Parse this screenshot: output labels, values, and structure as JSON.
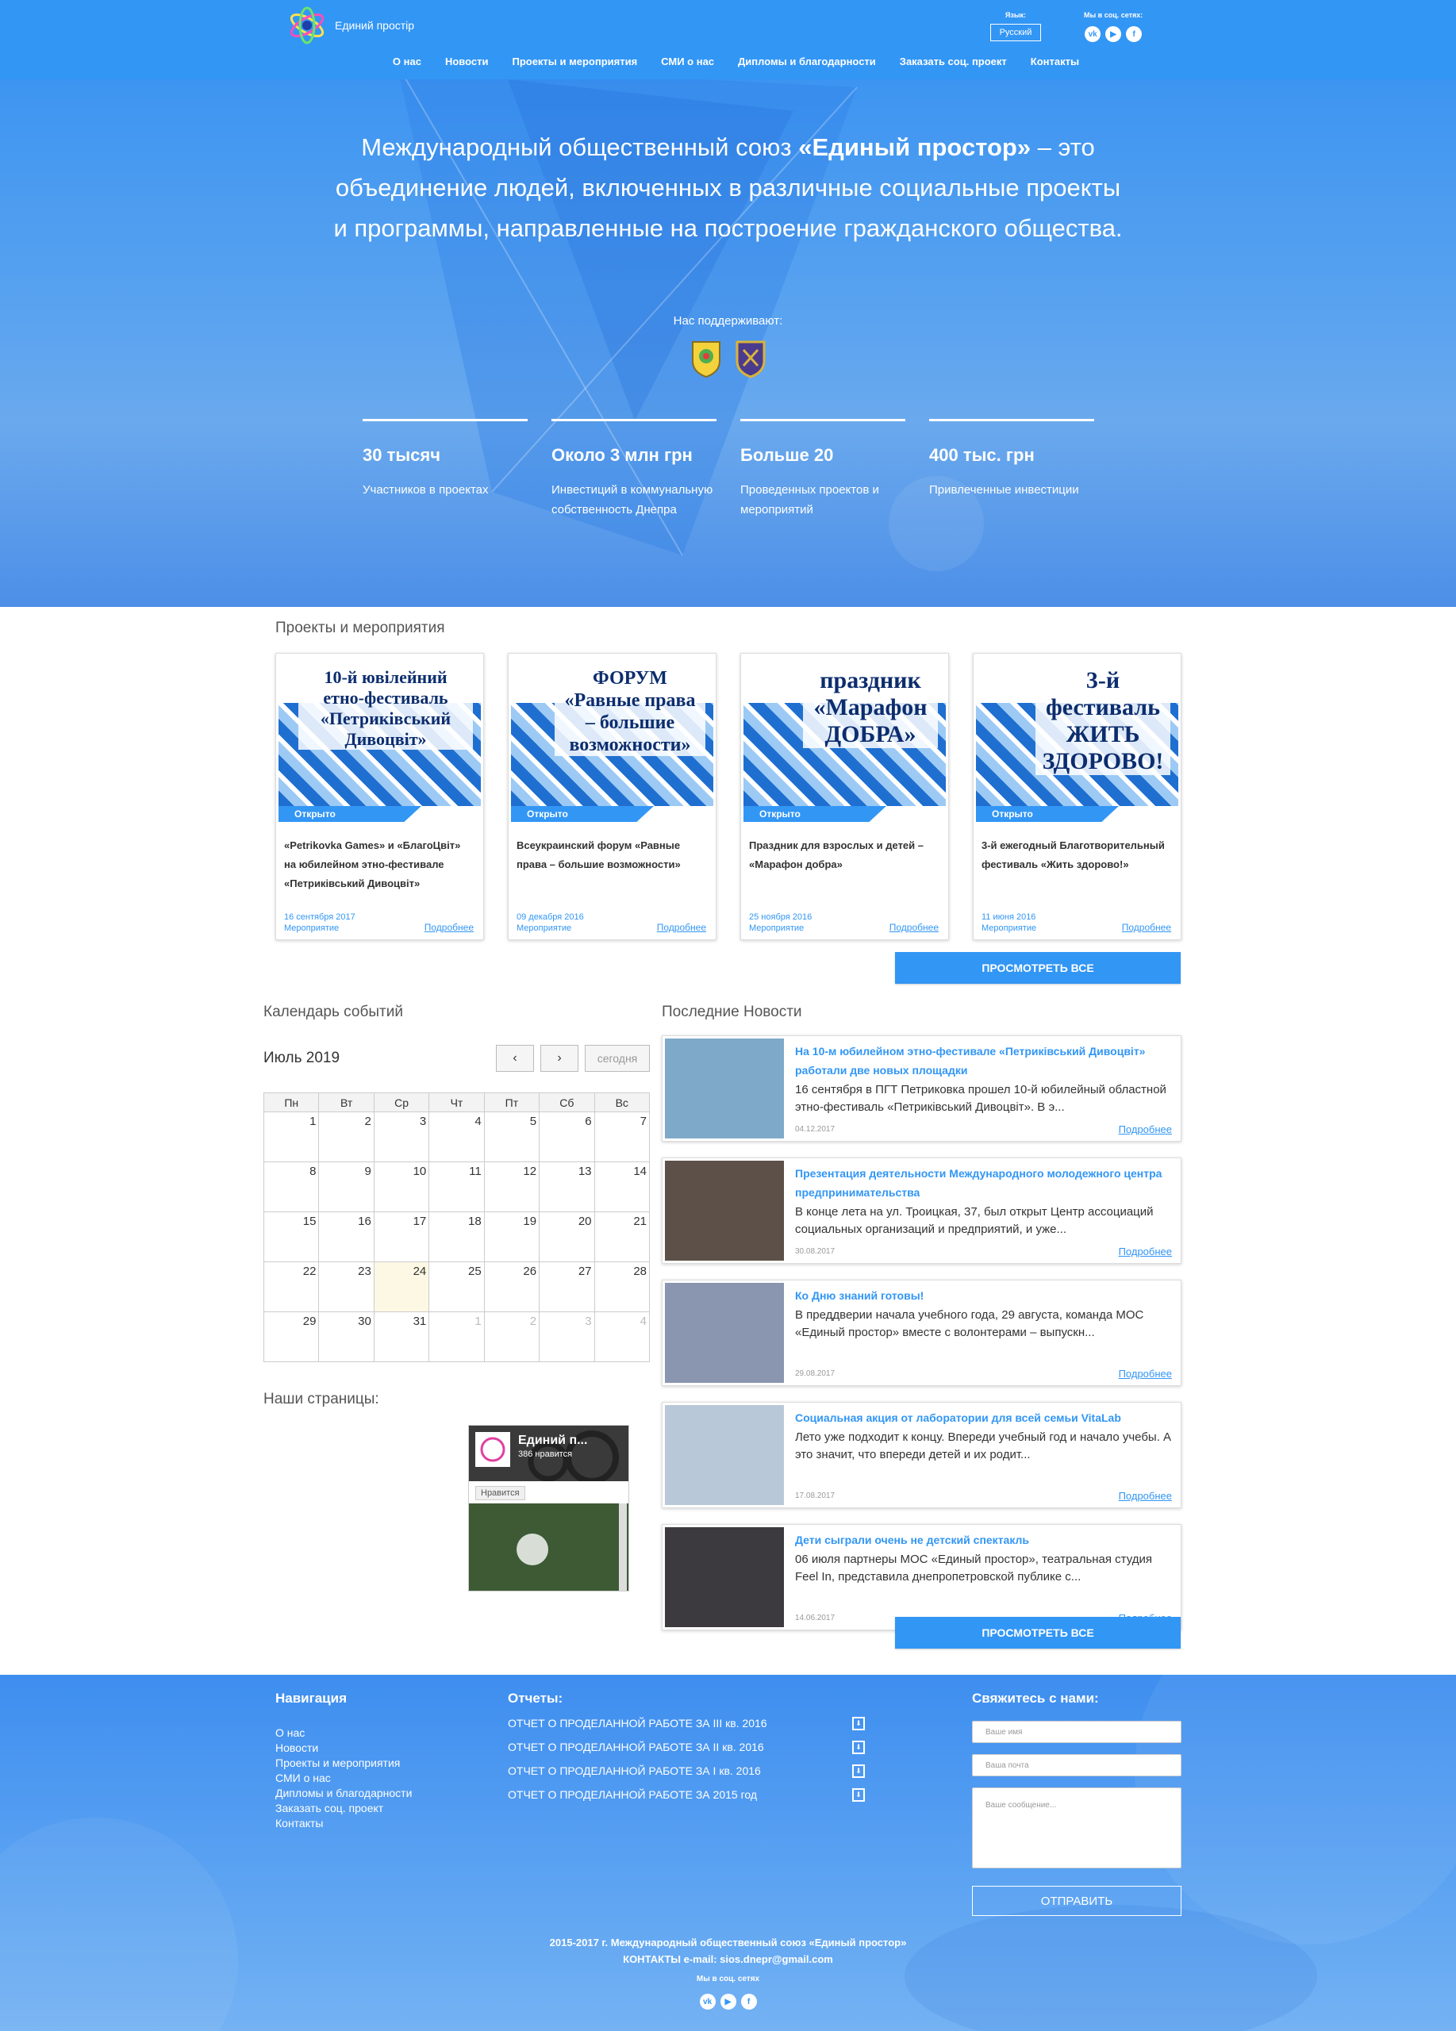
{
  "header": {
    "logo_text": "Единий простір",
    "lang_label": "Язык:",
    "lang_value": "Русский",
    "social_label": "Мы в соц. сетях:",
    "social_icons": [
      "vk-icon",
      "youtube-icon",
      "facebook-icon"
    ],
    "nav": [
      "О нас",
      "Новости",
      "Проекты и мероприятия",
      "СМИ о нас",
      "Дипломы и благодарности",
      "Заказать соц. проект",
      "Контакты"
    ]
  },
  "hero": {
    "text_before": "Международный общественный союз ",
    "text_bold": "«Единый простор»",
    "text_after": " – это объединение людей, включенных в различные социальные проекты и программы, направленные на построение гражданского общества.",
    "support_label": "Нас поддерживают:",
    "stats": [
      {
        "value": "30 тысяч",
        "label": "Участников в проектах"
      },
      {
        "value": "Около 3 млн грн",
        "label": "Инвестиций в коммунальную собственность Днепра"
      },
      {
        "value": "Больше 20",
        "label": "Проведенных проектов и мероприятий"
      },
      {
        "value": "400 тыс. грн",
        "label": "Привлеченные инвестиции"
      }
    ]
  },
  "projects": {
    "title": "Проекты и мероприятия",
    "cards": [
      {
        "poster": "10-й ювілейний етно-фестиваль «Петриківський Дивоцвіт»",
        "badge": "Открыто",
        "title": "«Petrikovka Games» и «БлагоЦвіт» на юбилейном этно-фестивале «Петриківський Дивоцвіт»",
        "date": "16 сентября 2017",
        "type": "Мероприятие",
        "more": "Подробнее"
      },
      {
        "poster": "ФОРУМ «Равные права – большие возможности»",
        "badge": "Открыто",
        "title": "Всеукраинский форум «Равные права – большие возможности»",
        "date": "09 декабря 2016",
        "type": "Мероприятие",
        "more": "Подробнее"
      },
      {
        "poster": "праздник «Марафон ДОБРА»",
        "badge": "Открыто",
        "title": "Праздник для взрослых и детей – «Марафон добра»",
        "date": "25 ноября 2016",
        "type": "Мероприятие",
        "more": "Подробнее"
      },
      {
        "poster": "3-й фестиваль ЖИТЬ ЗДОРОВО!",
        "badge": "Открыто",
        "title": "3-й ежегодный Благотворительный фестиваль «Жить здорово!»",
        "date": "11 июня 2016",
        "type": "Мероприятие",
        "more": "Подробнее"
      }
    ],
    "view_all": "ПРОСМОТРЕТЬ ВСЕ"
  },
  "calendar": {
    "title": "Календарь событий",
    "month": "Июль 2019",
    "prev": "‹",
    "next": "›",
    "today_btn": "сегодня",
    "weekdays": [
      "Пн",
      "Вт",
      "Ср",
      "Чт",
      "Пт",
      "Сб",
      "Вс"
    ],
    "weeks": [
      [
        "1",
        "2",
        "3",
        "4",
        "5",
        "6",
        "7"
      ],
      [
        "8",
        "9",
        "10",
        "11",
        "12",
        "13",
        "14"
      ],
      [
        "15",
        "16",
        "17",
        "18",
        "19",
        "20",
        "21"
      ],
      [
        "22",
        "23",
        "24",
        "25",
        "26",
        "27",
        "28"
      ],
      [
        "29",
        "30",
        "31",
        "1",
        "2",
        "3",
        "4"
      ]
    ],
    "today": "24"
  },
  "pages": {
    "title": "Наши страницы:",
    "fb_name": "Единий п...",
    "fb_likes": "386 нравится",
    "fb_like_btn": "Нравится"
  },
  "news": {
    "title": "Последние Новости",
    "items": [
      {
        "title": "На 10-м юбилейном этно-фестивале «Петриківський Дивоцвіт» работали две новых площадки",
        "text": "16 сентября в ПГТ Петриковка прошел 10-й юбилейный областной этно-фестиваль «Петриківський Дивоцвіт». В э...",
        "date": "04.12.2017",
        "more": "Подробнее",
        "img": "#7fa9c9"
      },
      {
        "title": "Презентация деятельности Международного молодежного центра предпринимательства",
        "text": "В конце лета на ул. Троицкая, 37, был открыт Центр ассоциаций социальных организаций и предприятий, и уже...",
        "date": "30.08.2017",
        "more": "Подробнее",
        "img": "#5c5048"
      },
      {
        "title": "Ко Дню знаний готовы!",
        "text": "В преддверии начала учебного года, 29 августа, команда МОС «Единый простор» вместе с волонтерами – выпускн...",
        "date": "29.08.2017",
        "more": "Подробнее",
        "img": "#8a95b0"
      },
      {
        "title": "Социальная акция от лаборатории для всей семьи VitaLab",
        "text": "Лето уже подходит к концу. Впереди учебный год и начало учебы. А это значит, что впереди детей и их родит...",
        "date": "17.08.2017",
        "more": "Подробнее",
        "img": "#b9c8d8"
      },
      {
        "title": "Дети сыграли очень не детский спектакль",
        "text": "06 июля партнеры МОС «Единый простор», театральная студия Feel In, представила днепропетровской публике с...",
        "date": "14.06.2017",
        "more": "Подробнее",
        "img": "#3c3a3e"
      }
    ],
    "view_all": "ПРОСМОТРЕТЬ ВСЕ"
  },
  "footer": {
    "nav_title": "Навигация",
    "nav": [
      "О нас",
      "Новости",
      "Проекты и мероприятия",
      "СМИ о нас",
      "Дипломы и благодарности",
      "Заказать соц. проект",
      "Контакты"
    ],
    "reports_title": "Отчеты:",
    "reports": [
      "ОТЧЕТ О ПРОДЕЛАННОЙ РАБОТЕ ЗА III кв. 2016",
      "ОТЧЕТ О ПРОДЕЛАННОЙ РАБОТЕ ЗА II кв. 2016",
      "ОТЧЕТ О ПРОДЕЛАННОЙ РАБОТЕ ЗА I кв. 2016",
      "ОТЧЕТ О ПРОДЕЛАННОЙ РАБОТЕ ЗА 2015 год"
    ],
    "contact_title": "Свяжитесь с нами:",
    "name_placeholder": "Ваше имя",
    "email_placeholder": "Ваша почта",
    "message_placeholder": "Ваше сообщение...",
    "send": "ОТПРАВИТЬ",
    "copyright": "2015-2017 г. Международный общественный союз «Единый простор»",
    "contacts": "КОНТАКТЫ e-mail: sios.dnepr@gmail.com",
    "social_label": "Мы в соц. сетях"
  },
  "colors": {
    "accent": "#3296f5",
    "link": "#3296f5",
    "today_cell": "#fcf8e3"
  }
}
